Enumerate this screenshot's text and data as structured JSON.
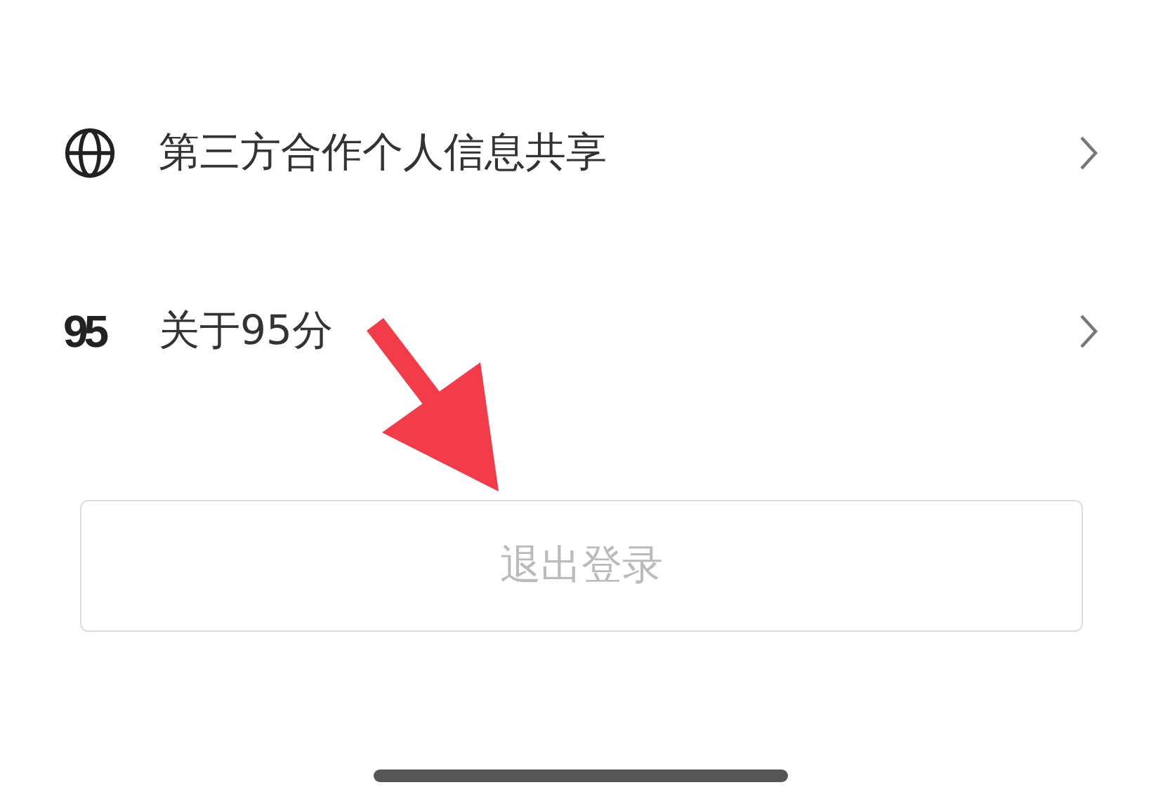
{
  "menu_items": [
    {
      "kind": "globe",
      "label": "第三方合作个人信息共享"
    },
    {
      "kind": "logo",
      "icon_text": "95",
      "label": "关于95分"
    }
  ],
  "logout_button": {
    "label": "退出登录"
  }
}
